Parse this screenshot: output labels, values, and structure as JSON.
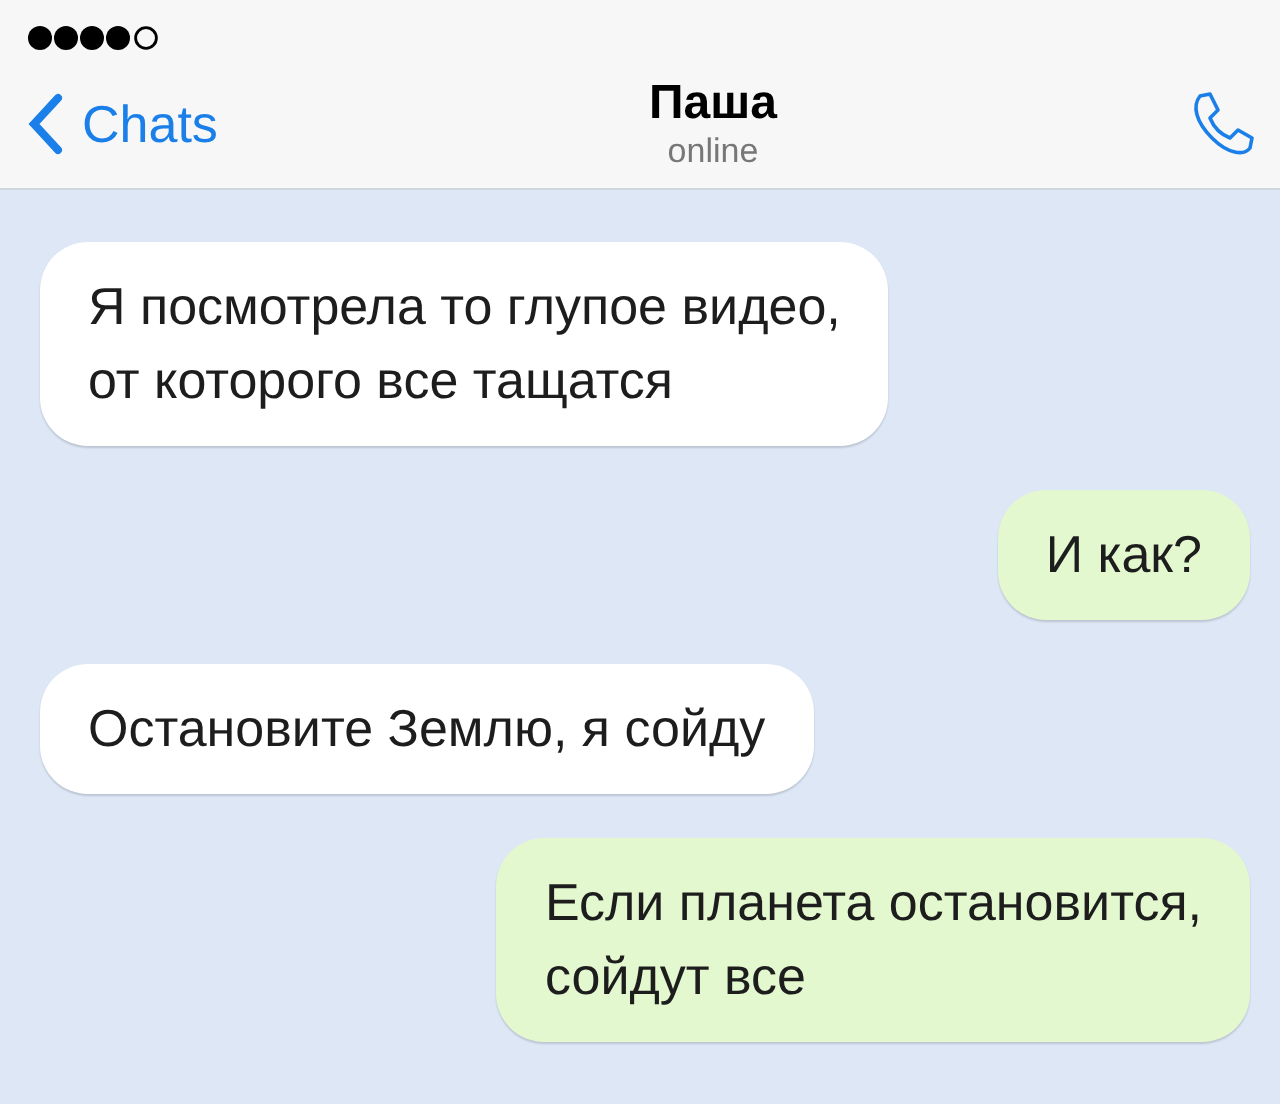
{
  "header": {
    "back_label": "Chats",
    "title": "Паша",
    "subtitle": "online"
  },
  "messages": [
    {
      "kind": "incoming",
      "text": "Я посмотрела то глупое видео,\nот которого все тащатся"
    },
    {
      "kind": "outgoing",
      "text": "И как?"
    },
    {
      "kind": "incoming",
      "text": "Остановите Землю, я сойду"
    },
    {
      "kind": "outgoing",
      "text": "Если планета остановится,\nсойдут все"
    }
  ]
}
